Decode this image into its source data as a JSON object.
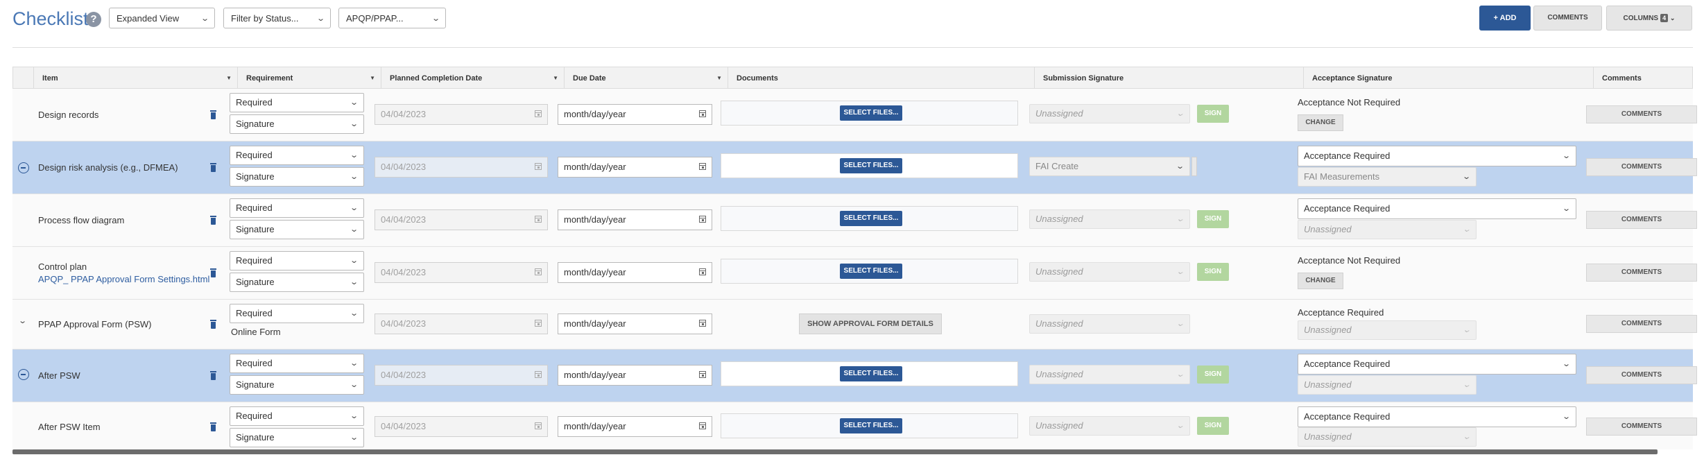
{
  "header": {
    "title": "Checklist",
    "help_glyph": "?",
    "view_select": "Expanded View",
    "status_filter": "Filter by Status...",
    "type_select": "APQP/PPAP...",
    "add_label": "+ ADD",
    "comments_label": "COMMENTS",
    "columns_label": "COLUMNS",
    "columns_count": "4"
  },
  "columns": [
    "Item",
    "Requirement",
    "Planned Completion Date",
    "Due Date",
    "Documents",
    "Submission Signature",
    "Acceptance Signature",
    "Comments"
  ],
  "labels": {
    "select_files": "SELECT FILES...",
    "sign": "SIGN",
    "change": "CHANGE",
    "comments": "COMMENTS",
    "show_form": "SHOW APPROVAL FORM DETAILS",
    "online_form": "Online Form"
  },
  "rows": [
    {
      "item": "Design records",
      "req": "Required",
      "req_type": "Signature",
      "planned": "04/04/2023",
      "due": "month/day/year",
      "submission": "Unassigned",
      "acceptance": "Acceptance Not Required"
    },
    {
      "item": "Design risk analysis (e.g., DFMEA)",
      "req": "Required",
      "req_type": "Signature",
      "planned": "04/04/2023",
      "due": "month/day/year",
      "submission": "FAI Create",
      "acceptance": "Acceptance Required",
      "acceptance_signer": "FAI Measurements"
    },
    {
      "item": "Process flow diagram",
      "req": "Required",
      "req_type": "Signature",
      "planned": "04/04/2023",
      "due": "month/day/year",
      "submission": "Unassigned",
      "acceptance": "Acceptance Required",
      "acceptance_signer": "Unassigned"
    },
    {
      "item": "Control plan",
      "link": "APQP_ PPAP Approval Form Settings.html",
      "req": "Required",
      "req_type": "Signature",
      "planned": "04/04/2023",
      "due": "month/day/year",
      "submission": "Unassigned",
      "acceptance": "Acceptance Not Required"
    },
    {
      "item": "PPAP Approval Form (PSW)",
      "req": "Required",
      "planned": "04/04/2023",
      "due": "month/day/year",
      "submission": "Unassigned",
      "acceptance": "Acceptance Required",
      "acceptance_signer": "Unassigned"
    },
    {
      "item": "After PSW",
      "req": "Required",
      "req_type": "Signature",
      "planned": "04/04/2023",
      "due": "month/day/year",
      "submission": "Unassigned",
      "acceptance": "Acceptance Required",
      "acceptance_signer": "Unassigned"
    },
    {
      "item": "After PSW Item",
      "req": "Required",
      "req_type": "Signature",
      "planned": "04/04/2023",
      "due": "month/day/year",
      "submission": "Unassigned",
      "acceptance": "Acceptance Required",
      "acceptance_signer": "Unassigned"
    }
  ],
  "colors": {
    "primary": "#2c5896",
    "title": "#4a78b5",
    "selected_row": "#bed3ef",
    "sign_disabled": "#b2d69f"
  },
  "icons": {
    "help": "help-icon",
    "chevron": "chevron-down-icon",
    "trash": "trash-icon",
    "collapse": "collapse-icon",
    "calendar": "calendar-icon",
    "sort": "sort-icon"
  }
}
